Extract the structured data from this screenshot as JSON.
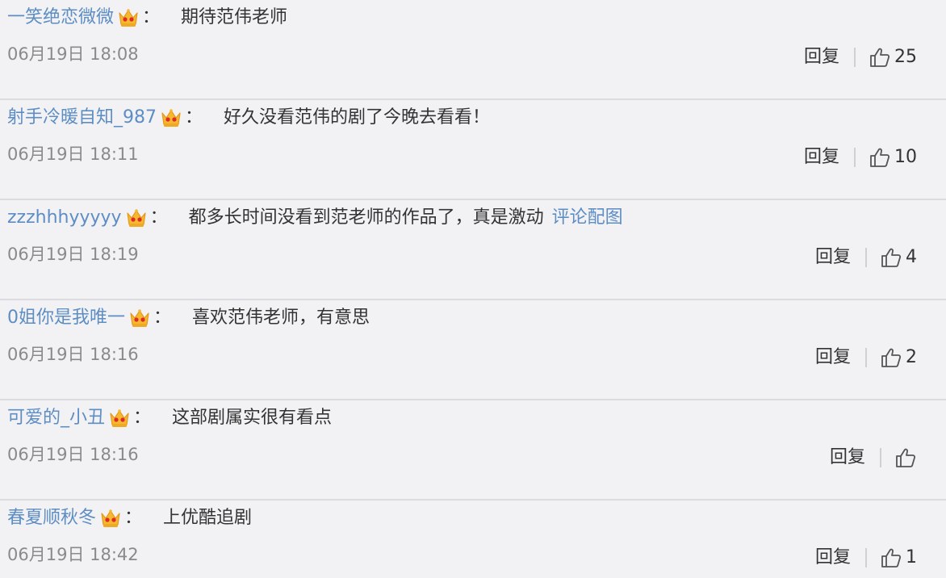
{
  "comments": [
    {
      "username": "一笑绝恋微微",
      "content": "期待范伟老师",
      "attachment": "",
      "time": "06月19日 18:08",
      "reply_label": "回复",
      "likes": "25"
    },
    {
      "username": "射手冷暖自知_987",
      "content": "好久没看范伟的剧了今晚去看看！",
      "attachment": "",
      "time": "06月19日 18:11",
      "reply_label": "回复",
      "likes": "10"
    },
    {
      "username": "zzzhhhyyyyy",
      "content": "都多长时间没看到范老师的作品了，真是激动",
      "attachment": "评论配图",
      "time": "06月19日 18:19",
      "reply_label": "回复",
      "likes": "4"
    },
    {
      "username": "0姐你是我唯一",
      "content": "喜欢范伟老师，有意思",
      "attachment": "",
      "time": "06月19日 18:16",
      "reply_label": "回复",
      "likes": "2"
    },
    {
      "username": "可爱的_小丑",
      "content": "这部剧属实很有看点",
      "attachment": "",
      "time": "06月19日 18:16",
      "reply_label": "回复",
      "likes": ""
    },
    {
      "username": "春夏顺秋冬",
      "content": "上优酷追剧",
      "attachment": "",
      "time": "06月19日 18:42",
      "reply_label": "回复",
      "likes": "1"
    }
  ],
  "colon": "：",
  "icons": {
    "badge": "crown-icon",
    "like": "thumbs-up-icon"
  },
  "colors": {
    "username": "#5d8dc3",
    "text": "#333333",
    "time": "#8a8a8a",
    "background": "#f2f2f5",
    "crown": "#f5b82e"
  }
}
